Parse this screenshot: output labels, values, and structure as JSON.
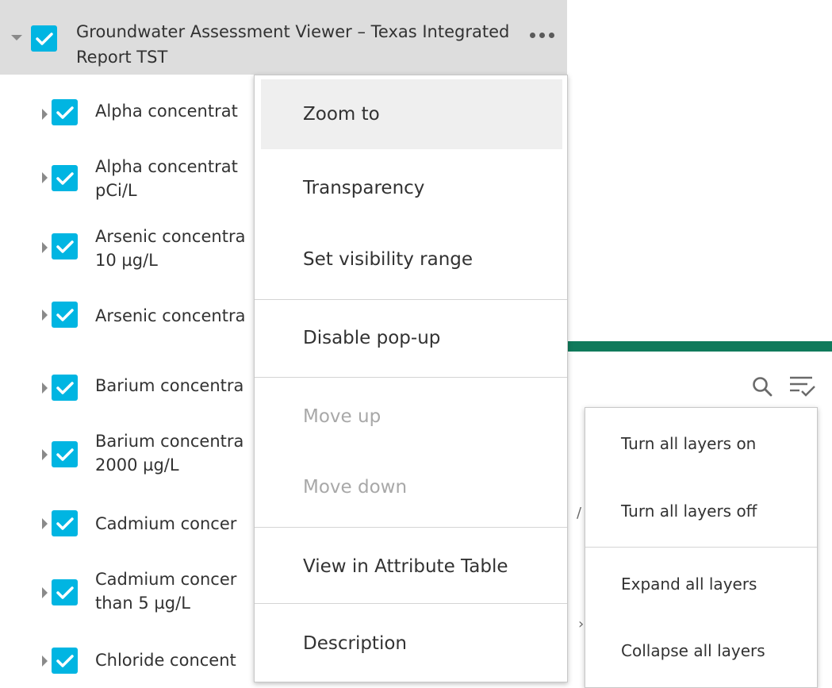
{
  "header": {
    "title": "Groundwater Assessment Viewer – Texas Integrated Report TST",
    "menu_icon": "more-horizontal-icon"
  },
  "layers": [
    {
      "label_line1": "Alpha concentrat",
      "label_line2": ""
    },
    {
      "label_line1": "Alpha concentrat",
      "label_line2": "pCi/L"
    },
    {
      "label_line1": "Arsenic concentra",
      "label_line2": "10 µg/L"
    },
    {
      "label_line1": "Arsenic concentra",
      "label_line2": ""
    },
    {
      "label_line1": "Barium concentra",
      "label_line2": ""
    },
    {
      "label_line1": "Barium concentra",
      "label_line2": "2000 µg/L"
    },
    {
      "label_line1": "Cadmium concer",
      "label_line2": ""
    },
    {
      "label_line1": "Cadmium concer",
      "label_line2": "than 5 µg/L"
    },
    {
      "label_line1": "Chloride concent",
      "label_line2": ""
    }
  ],
  "layer_menu": {
    "zoom_to": "Zoom to",
    "transparency": "Transparency",
    "visibility_range": "Set visibility range",
    "disable_popup": "Disable pop-up",
    "move_up": "Move up",
    "move_down": "Move down",
    "attribute_table": "View in Attribute Table",
    "description": "Description"
  },
  "global_menu": {
    "turn_on": "Turn all layers on",
    "turn_off": "Turn all layers off",
    "expand": "Expand all layers",
    "collapse": "Collapse all layers"
  },
  "colors": {
    "checkbox": "#00b5e2",
    "accent_bar": "#0f7a5b",
    "header_bg": "#dddddd"
  }
}
